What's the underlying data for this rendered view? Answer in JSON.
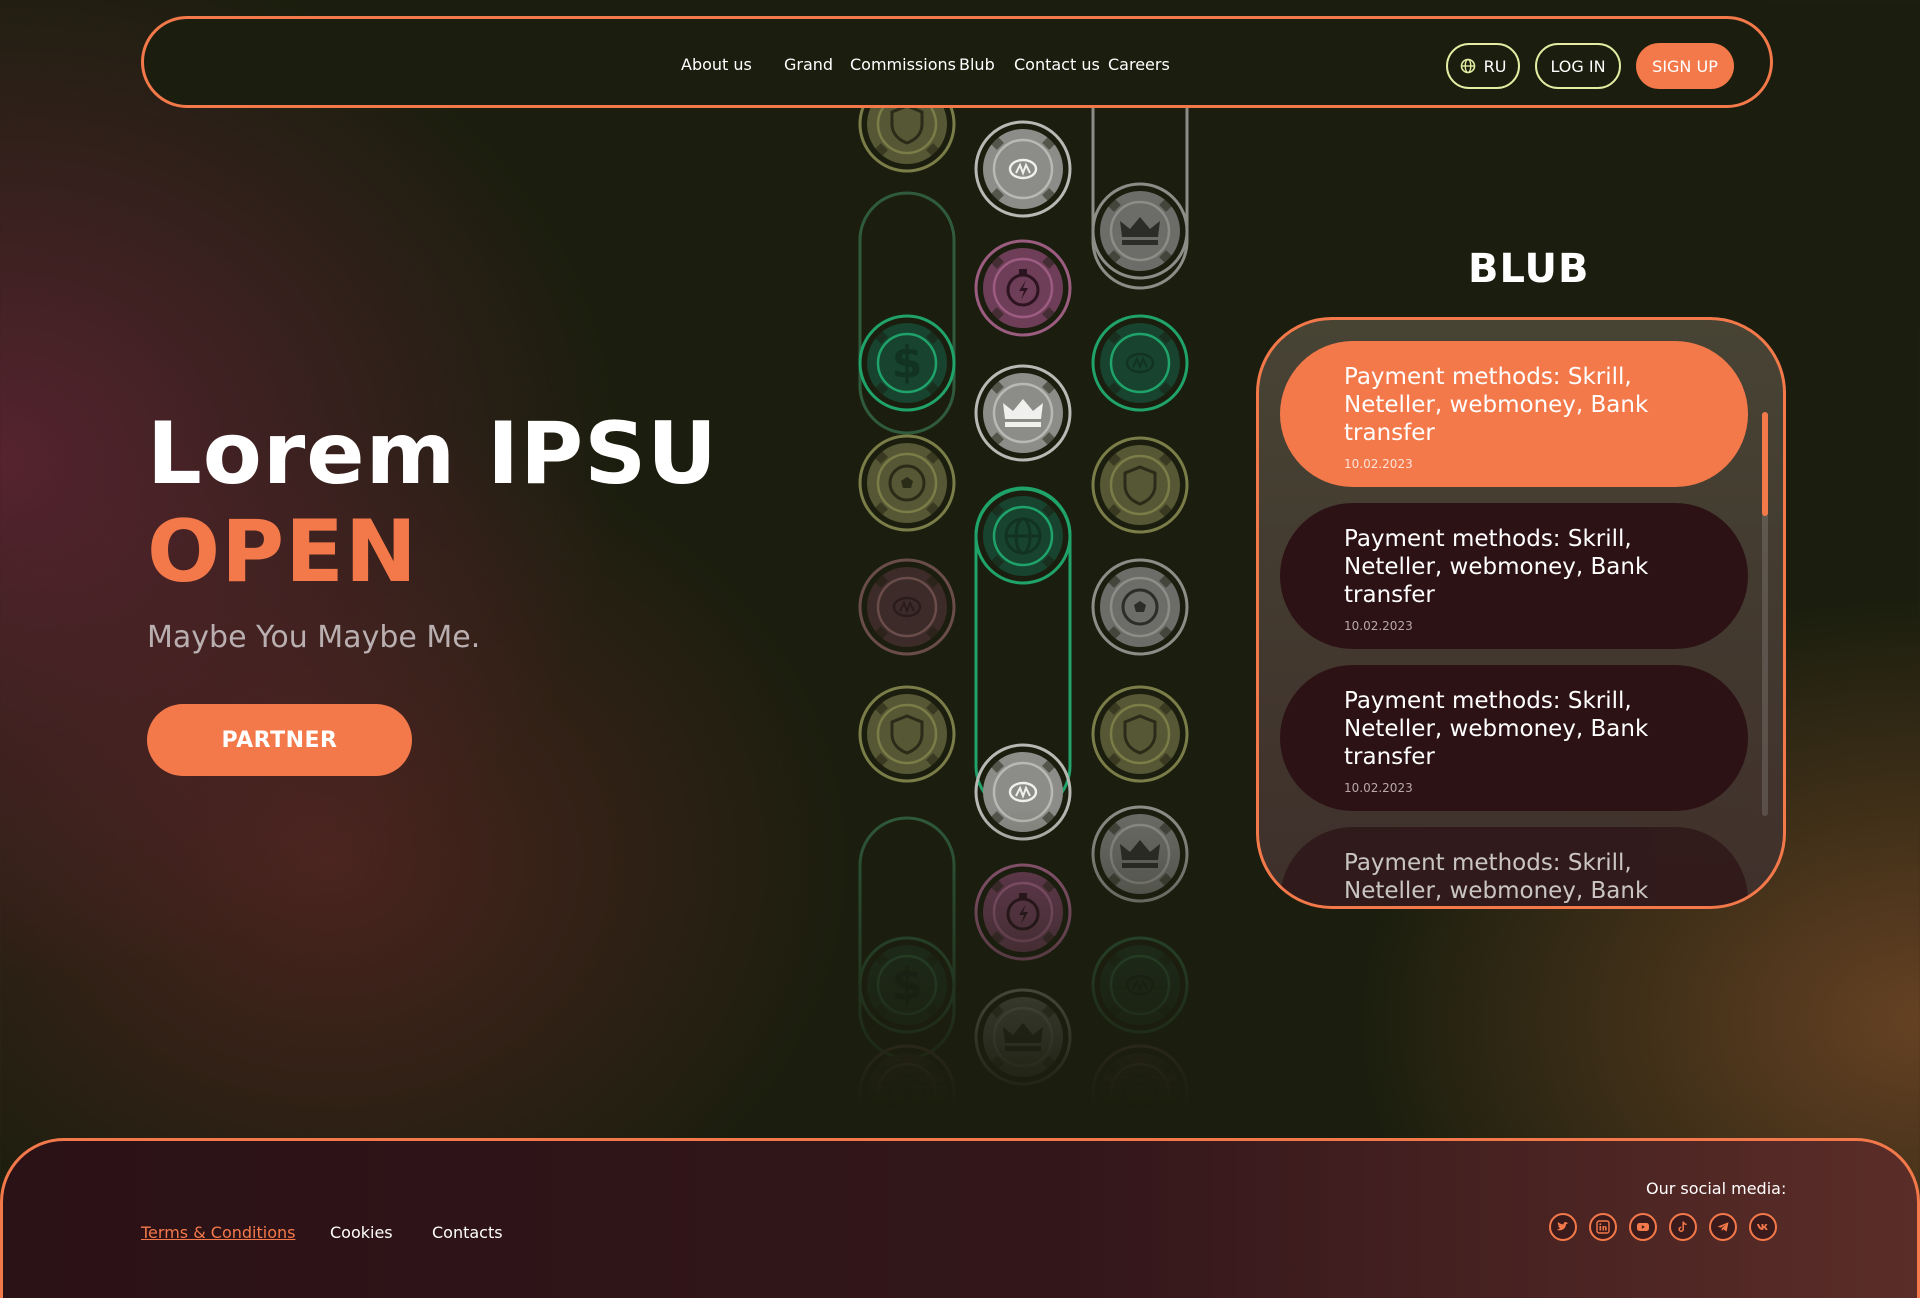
{
  "nav": {
    "links": [
      "About us",
      "Grand",
      "Commissions",
      "Blub",
      "Contact us",
      "Careers"
    ],
    "lang_label": "RU",
    "login_label": "LOG IN",
    "signup_label": "SIGN UP"
  },
  "hero": {
    "title_line1": "Lorem IPSU",
    "title_line2": "OPEN",
    "subtitle": "Maybe You Maybe Me.",
    "cta_label": "PARTNER"
  },
  "news": {
    "heading": "BLUB",
    "items": [
      {
        "title": "Payment methods: Skrill, Neteller, webmoney, Bank transfer",
        "date": "10.02.2023",
        "active": true
      },
      {
        "title": "Payment methods: Skrill, Neteller, webmoney, Bank transfer",
        "date": "10.02.2023",
        "active": false
      },
      {
        "title": "Payment methods: Skrill, Neteller, webmoney, Bank transfer",
        "date": "10.02.2023",
        "active": false
      },
      {
        "title": "Payment methods: Skrill, Neteller, webmoney, Bank transfer",
        "date": "",
        "active": false
      }
    ]
  },
  "footer": {
    "links": [
      "Terms & Conditions",
      "Cookies",
      "Contacts"
    ],
    "social_label": "Our social media:",
    "social_icons": [
      "twitter-icon",
      "linkedin-icon",
      "youtube-icon",
      "tiktok-icon",
      "telegram-icon",
      "vk-icon"
    ]
  },
  "chips": {
    "icons": [
      "shield-icon",
      "coin-icon",
      "crown-icon",
      "stopwatch-icon",
      "dollar-icon",
      "football-icon",
      "globe-icon"
    ]
  },
  "colors": {
    "accent": "#f4794a",
    "background": "#1b1e0e",
    "card_dark": "#2c1215",
    "outline_button": "#e3eca2",
    "chip_green": "#1fa36a",
    "chip_olive": "#7b7d48",
    "chip_grey": "#8d8d88",
    "chip_pink": "#9b5c80"
  }
}
